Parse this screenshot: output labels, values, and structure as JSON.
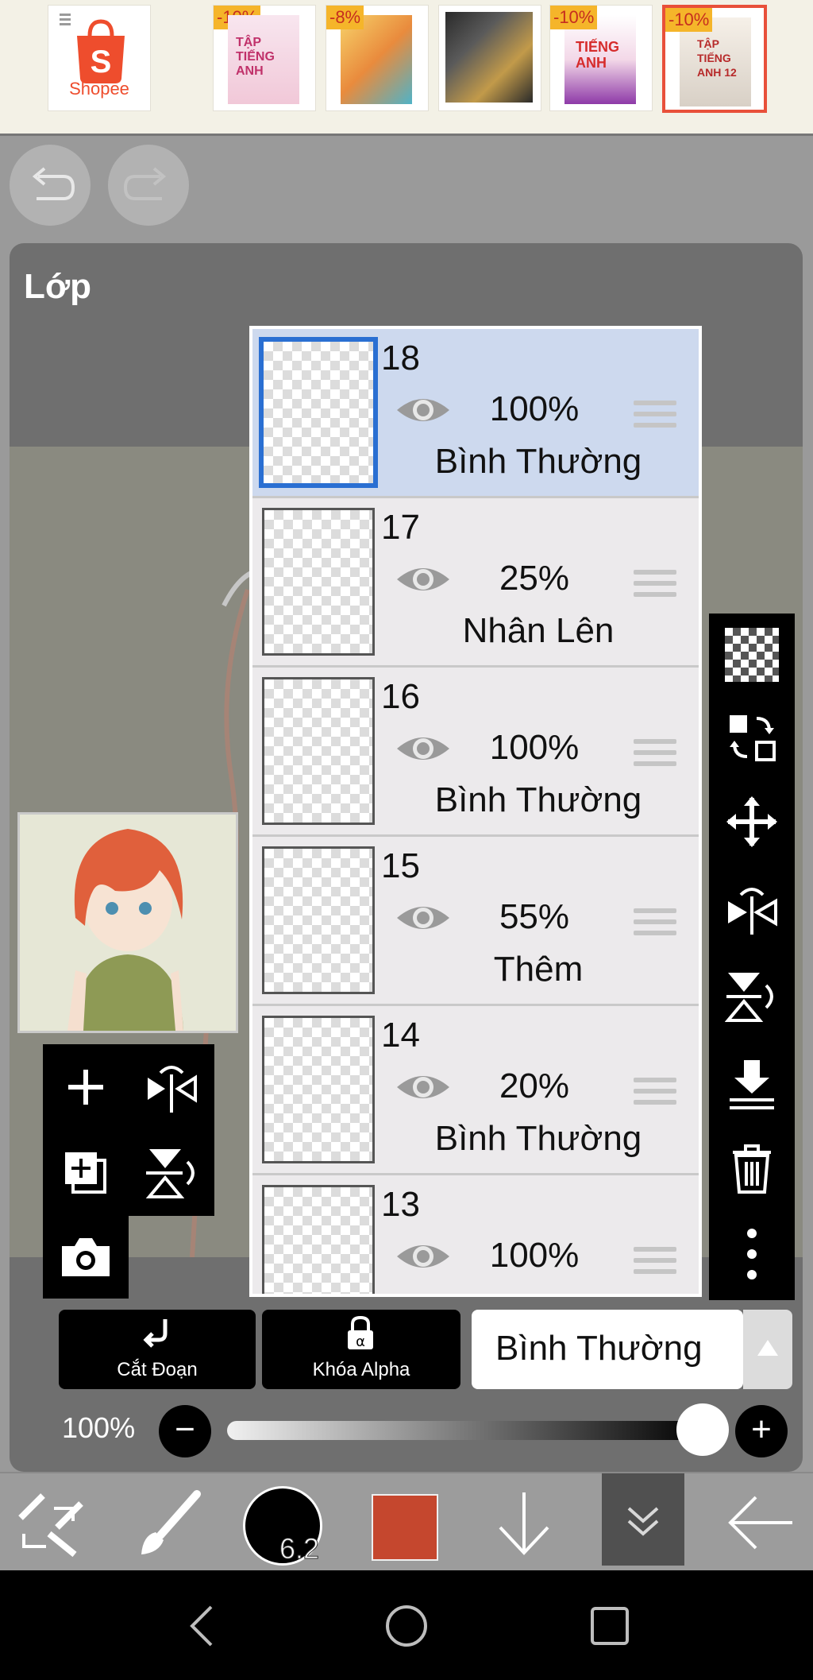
{
  "ad_banner": {
    "store_name": "Shopee",
    "tiles": [
      {
        "discount": "",
        "title": "Shopee"
      },
      {
        "discount": "-10%",
        "title": "TẬP TIẾNG ANH"
      },
      {
        "discount": "-8%",
        "title": ""
      },
      {
        "discount": "",
        "title": ""
      },
      {
        "discount": "-10%",
        "title": "TIẾNG ANH"
      },
      {
        "discount": "-10%",
        "title": "TẬP TIẾNG ANH 12"
      }
    ]
  },
  "header": {
    "undo_icon": "undo-icon",
    "redo_icon": "redo-icon"
  },
  "panel": {
    "title": "Lớp",
    "layers": [
      {
        "number": "18",
        "opacity": "100%",
        "blend_mode": "Bình Thường",
        "selected": true
      },
      {
        "number": "17",
        "opacity": "25%",
        "blend_mode": "Nhân Lên",
        "selected": false
      },
      {
        "number": "16",
        "opacity": "100%",
        "blend_mode": "Bình Thường",
        "selected": false
      },
      {
        "number": "15",
        "opacity": "55%",
        "blend_mode": "Thêm",
        "selected": false
      },
      {
        "number": "14",
        "opacity": "20%",
        "blend_mode": "Bình Thường",
        "selected": false
      },
      {
        "number": "13",
        "opacity": "100%",
        "blend_mode": "",
        "selected": false
      }
    ],
    "right_tools": [
      "transparency-icon",
      "swap-layer-icon",
      "move-icon",
      "flip-horizontal-icon",
      "flip-vertical-icon",
      "merge-down-icon",
      "trash-icon",
      "more-icon"
    ],
    "left_tools": [
      "add-layer-icon",
      "flip-layer-horizontal-icon",
      "duplicate-layer-icon",
      "flip-layer-vertical-icon",
      "camera-icon"
    ],
    "clipping": {
      "label": "Cắt Đoạn"
    },
    "alpha_lock": {
      "label": "Khóa Alpha"
    },
    "blend_select": {
      "value": "Bình Thường"
    },
    "opacity": {
      "label": "100%",
      "value": 1.0
    }
  },
  "toolbar": {
    "brush_size": "6.2",
    "color": "#c5472e",
    "tools": [
      "transform-icon",
      "brush-icon",
      "brush-size",
      "color-swatch",
      "arrow-down-icon",
      "collapse-icon",
      "back-arrow-icon"
    ]
  },
  "navbar": [
    "back-icon",
    "home-icon",
    "recents-icon"
  ]
}
